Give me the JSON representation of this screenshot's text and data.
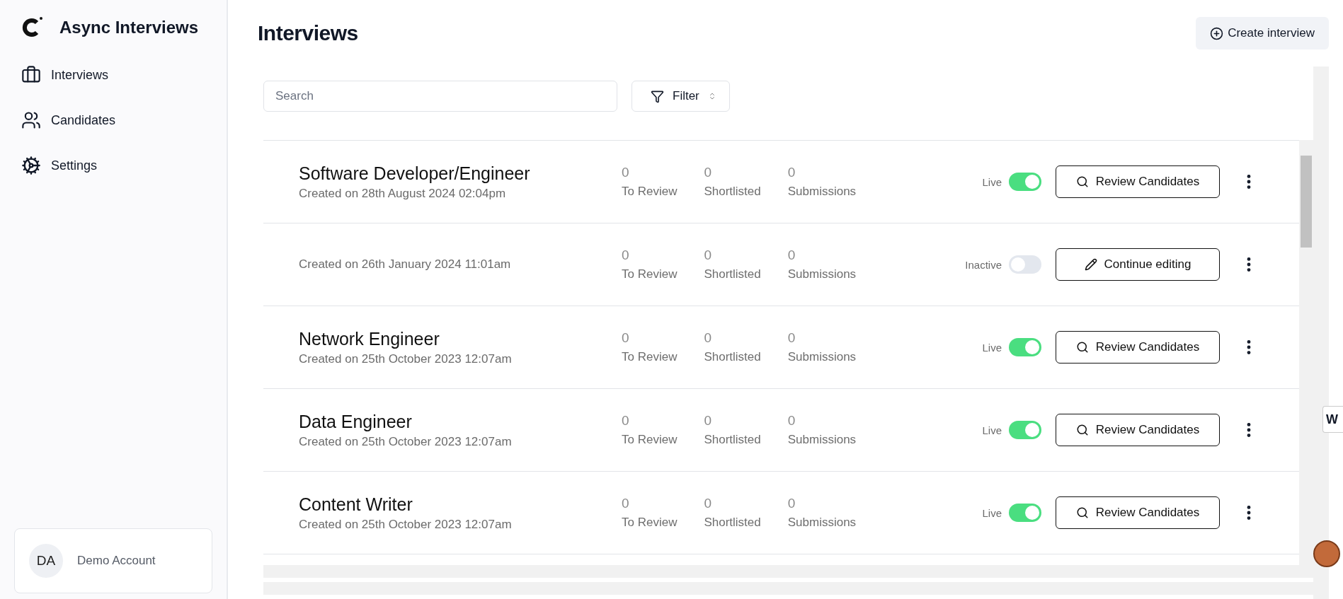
{
  "sidebar": {
    "brand": "Async Interviews",
    "items": [
      {
        "label": "Interviews",
        "kind": "briefcase"
      },
      {
        "label": "Candidates",
        "kind": "users"
      },
      {
        "label": "Settings",
        "kind": "gear"
      }
    ],
    "account": {
      "initials": "DA",
      "name": "Demo Account"
    }
  },
  "header": {
    "title": "Interviews",
    "create_button": "Create interview"
  },
  "search": {
    "placeholder": "Search"
  },
  "filter": {
    "label": "Filter"
  },
  "rows": [
    {
      "title": "Software Developer/Engineer",
      "created": "Created on 28th August 2024 02:04pm",
      "stats": [
        {
          "value": "0",
          "label": "To Review"
        },
        {
          "value": "0",
          "label": "Shortlisted"
        },
        {
          "value": "0",
          "label": "Submissions"
        }
      ],
      "status": "Live",
      "on": true,
      "action": {
        "kind": "review",
        "label": "Review Candidates"
      }
    },
    {
      "created": "Created on 26th January 2024 11:01am",
      "stats": [
        {
          "value": "0",
          "label": "To Review"
        },
        {
          "value": "0",
          "label": "Shortlisted"
        },
        {
          "value": "0",
          "label": "Submissions"
        }
      ],
      "status": "Inactive",
      "on": false,
      "action": {
        "kind": "edit",
        "label": "Continue editing"
      }
    },
    {
      "title": "Network Engineer",
      "created": "Created on 25th October 2023 12:07am",
      "stats": [
        {
          "value": "0",
          "label": "To Review"
        },
        {
          "value": "0",
          "label": "Shortlisted"
        },
        {
          "value": "0",
          "label": "Submissions"
        }
      ],
      "status": "Live",
      "on": true,
      "action": {
        "kind": "review",
        "label": "Review Candidates"
      }
    },
    {
      "title": "Data Engineer",
      "created": "Created on 25th October 2023 12:07am",
      "stats": [
        {
          "value": "0",
          "label": "To Review"
        },
        {
          "value": "0",
          "label": "Shortlisted"
        },
        {
          "value": "0",
          "label": "Submissions"
        }
      ],
      "status": "Live",
      "on": true,
      "action": {
        "kind": "review",
        "label": "Review Candidates"
      }
    },
    {
      "title": "Content Writer",
      "created": "Created on 25th October 2023 12:07am",
      "stats": [
        {
          "value": "0",
          "label": "To Review"
        },
        {
          "value": "0",
          "label": "Shortlisted"
        },
        {
          "value": "0",
          "label": "Submissions"
        }
      ],
      "status": "Live",
      "on": true,
      "action": {
        "kind": "review",
        "label": "Review Candidates"
      }
    }
  ],
  "side_tab": {
    "label": "W"
  }
}
